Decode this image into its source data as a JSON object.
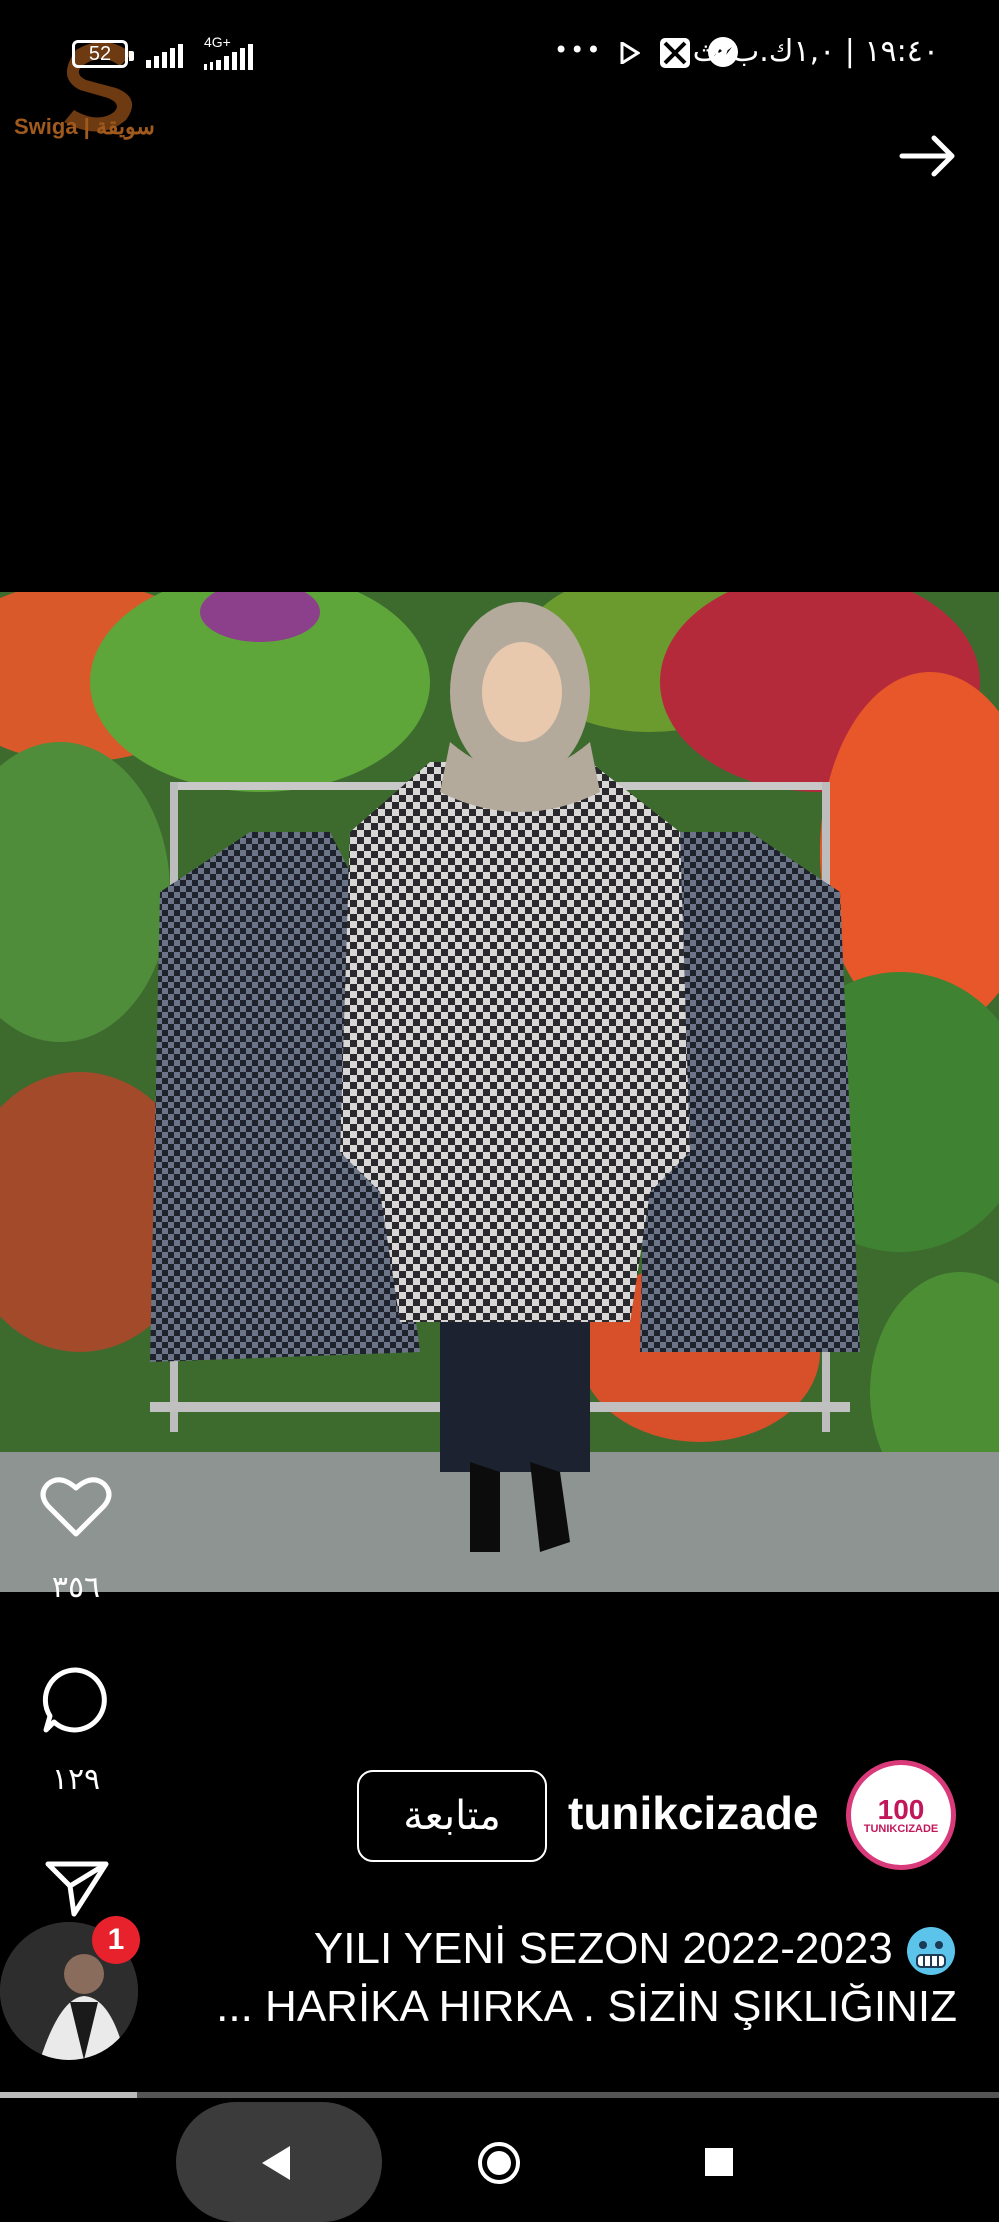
{
  "status_bar": {
    "battery": "52",
    "network": "4G+",
    "more": "•••",
    "time_date": "١٩:٤٠ | ١,٠ك.ب/ث"
  },
  "watermark": {
    "text": "Swiga | سويقة"
  },
  "header": {
    "forward_icon": "arrow-right-icon"
  },
  "actions": {
    "likes": "٣٥٦",
    "comments": "١٢٩"
  },
  "profile": {
    "follow_label": "متابعة",
    "username": "tunikcizade",
    "avatar_text": "100",
    "avatar_brand": "TUNIKCIZADE"
  },
  "caption": {
    "line1": "YILI YENİ SEZON 2022-2023",
    "line2": "... HARİKA HIRKA . SİZİN ŞIKLIĞINIZ"
  },
  "chat_head": {
    "badge": "1"
  },
  "progress": {
    "fraction": 0.137
  },
  "colors": {
    "badge": "#e8222c",
    "avatar_ring": "#d83a7a",
    "logo": "#a05a1e"
  }
}
